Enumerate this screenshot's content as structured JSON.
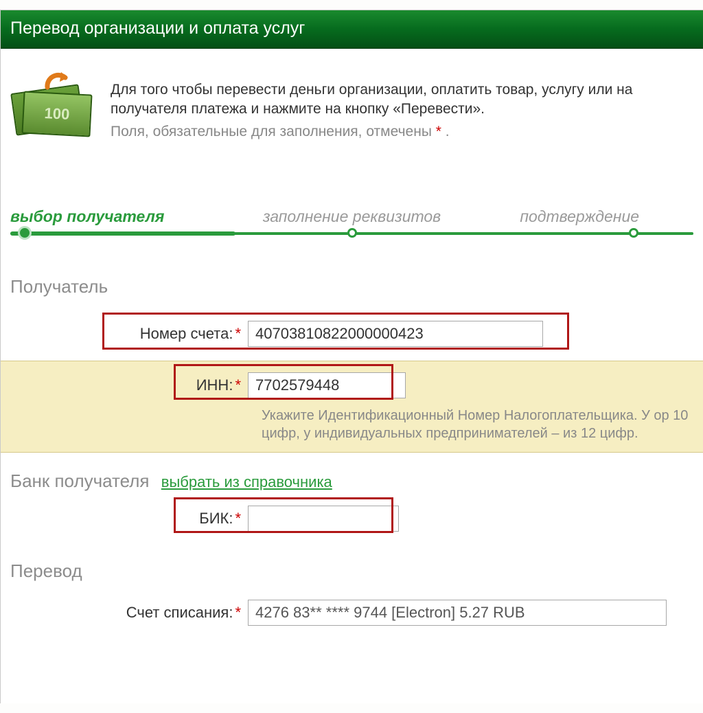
{
  "header": {
    "title": "Перевод организации и оплата услуг"
  },
  "intro": {
    "line1": "Для того чтобы перевести деньги организации, оплатить товар, услугу или на получателя платежа и нажмите на кнопку «Перевести».",
    "line2_prefix": "Поля, обязательные для заполнения, отмечены ",
    "asterisk": "*",
    "line2_suffix": " ."
  },
  "stepper": {
    "step1": "выбор получателя",
    "step2": "заполнение реквизитов",
    "step3": "подтверждение"
  },
  "sections": {
    "recipient": "Получатель",
    "bank": "Банк получателя",
    "bank_link": "выбрать из справочника",
    "transfer": "Перевод"
  },
  "fields": {
    "account": {
      "label": "Номер счета:",
      "value": "40703810822000000423"
    },
    "inn": {
      "label": "ИНН:",
      "value": "7702579448",
      "hint": "Укажите Идентификационный Номер Налогоплательщика. У ор 10 цифр, у индивидуальных предпринимателей – из 12 цифр."
    },
    "bik": {
      "label": "БИК:",
      "value": ""
    },
    "debit_account": {
      "label": "Счет списания:",
      "value": "4276 83** **** 9744 [Electron] 5.27 RUB"
    }
  }
}
